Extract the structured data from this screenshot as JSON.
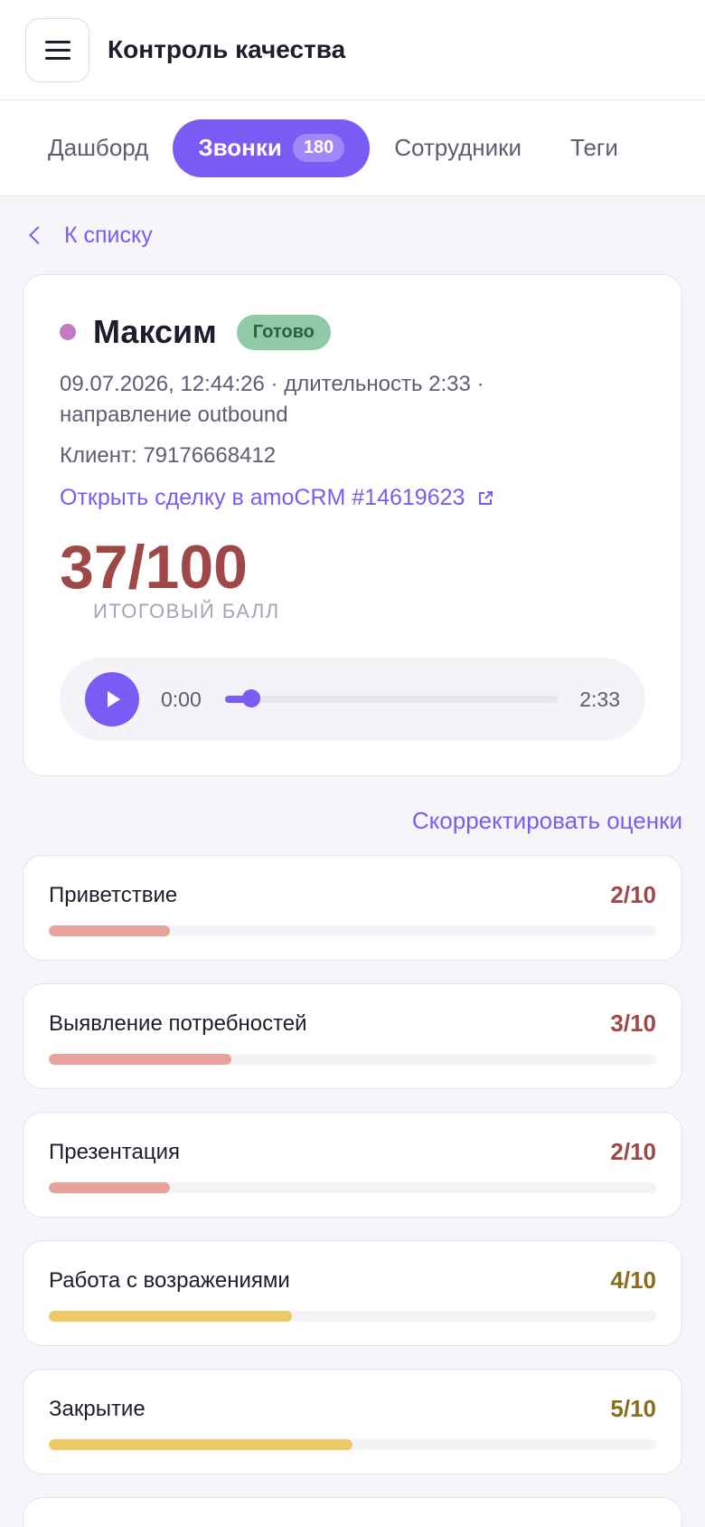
{
  "header": {
    "title": "Контроль качества"
  },
  "tabs": [
    {
      "label": "Дашборд",
      "active": false
    },
    {
      "label": "Звонки",
      "active": true,
      "badge": "180"
    },
    {
      "label": "Сотрудники",
      "active": false
    },
    {
      "label": "Теги",
      "active": false
    }
  ],
  "back": {
    "label": "К списку"
  },
  "call": {
    "name": "Максим",
    "status": "Готово",
    "meta_line1": "09.07.2026, 12:44:26 · длительность 2:33 ·",
    "meta_line2": "направление outbound",
    "client": "Клиент: 79176668412",
    "crm_link": "Открыть сделку в amoCRM #14619623",
    "score": "37/100",
    "score_label": "ИТОГОВЫЙ БАЛЛ"
  },
  "player": {
    "current": "0:00",
    "duration": "2:33",
    "progress": 0.08
  },
  "adjust_label": "Скорректировать оценки",
  "criteria": [
    {
      "name": "Приветствие",
      "score": "2/10",
      "value": 2,
      "level": "low"
    },
    {
      "name": "Выявление потребностей",
      "score": "3/10",
      "value": 3,
      "level": "low"
    },
    {
      "name": "Презентация",
      "score": "2/10",
      "value": 2,
      "level": "low"
    },
    {
      "name": "Работа с возражениями",
      "score": "4/10",
      "value": 4,
      "level": "mid"
    },
    {
      "name": "Закрытие",
      "score": "5/10",
      "value": 5,
      "level": "mid"
    }
  ],
  "colors": {
    "accent": "#7a5cf5",
    "low_bar": "#e8a19b",
    "low_text": "#9f4848",
    "mid_bar": "#efc866",
    "mid_text": "#8a6d1c"
  }
}
